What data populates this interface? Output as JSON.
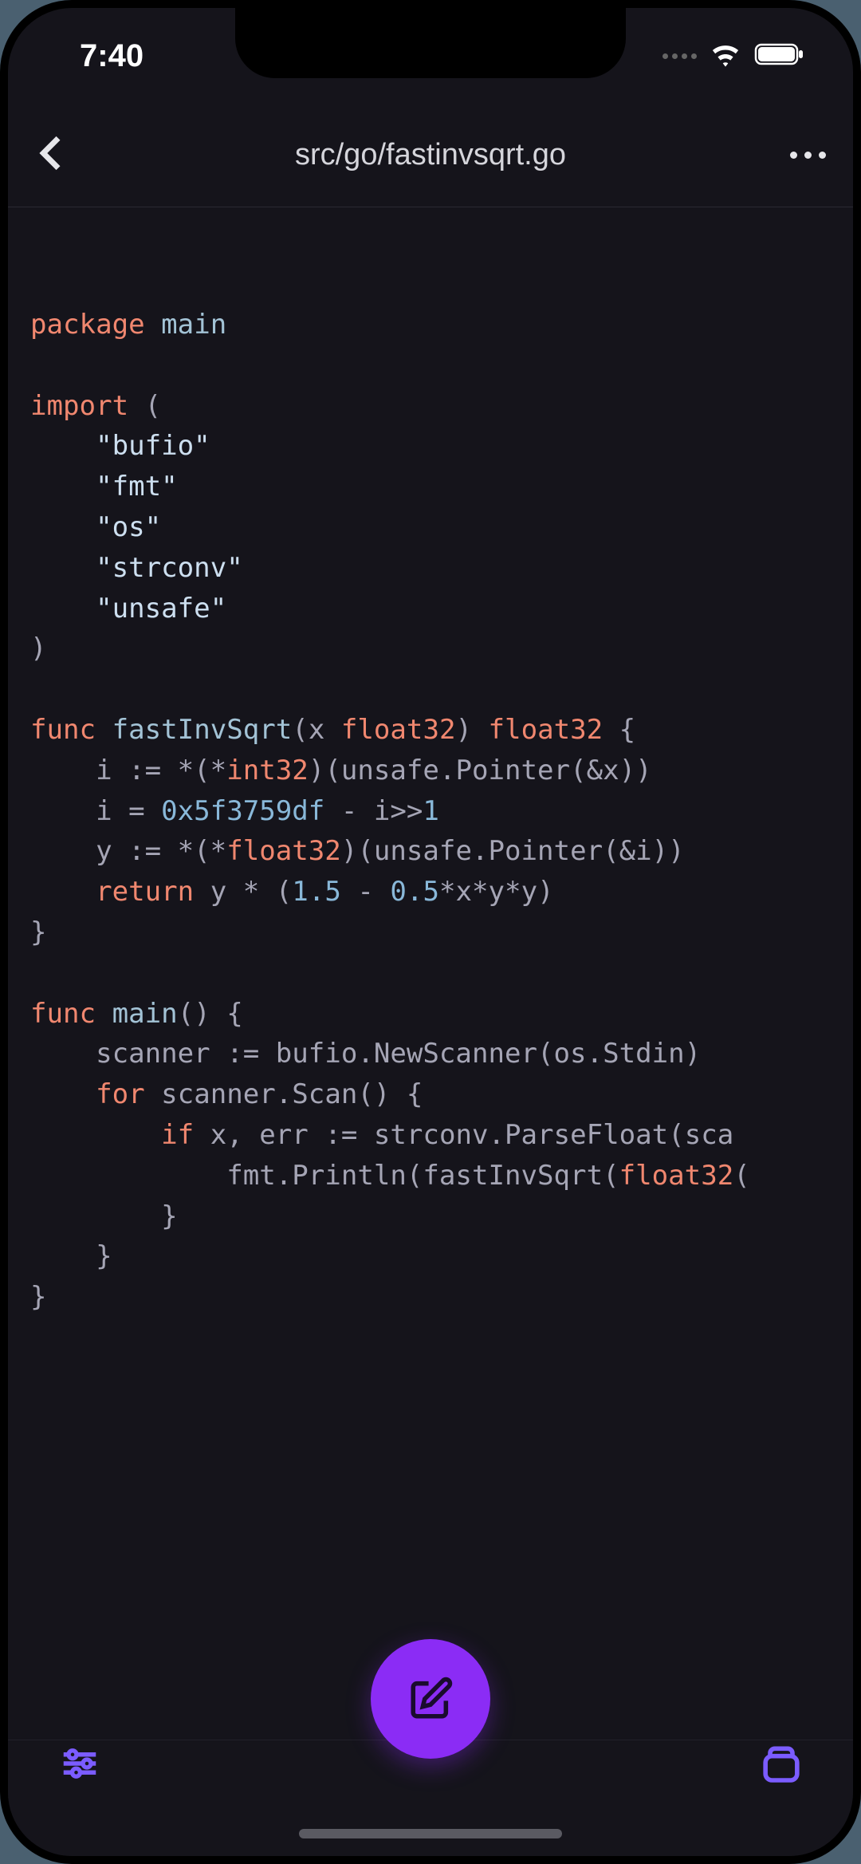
{
  "statusbar": {
    "time": "7:40"
  },
  "navbar": {
    "title": "src/go/fastinvsqrt.go"
  },
  "code": {
    "tokens": [
      [
        [
          "kw",
          "package"
        ],
        [
          "op",
          " "
        ],
        [
          "name",
          "main"
        ]
      ],
      [],
      [
        [
          "kw",
          "import"
        ],
        [
          "op",
          " ("
        ]
      ],
      [
        [
          "op",
          "    "
        ],
        [
          "str",
          "\"bufio\""
        ]
      ],
      [
        [
          "op",
          "    "
        ],
        [
          "str",
          "\"fmt\""
        ]
      ],
      [
        [
          "op",
          "    "
        ],
        [
          "str",
          "\"os\""
        ]
      ],
      [
        [
          "op",
          "    "
        ],
        [
          "str",
          "\"strconv\""
        ]
      ],
      [
        [
          "op",
          "    "
        ],
        [
          "str",
          "\"unsafe\""
        ]
      ],
      [
        [
          "op",
          ")"
        ]
      ],
      [],
      [
        [
          "kw",
          "func"
        ],
        [
          "op",
          " "
        ],
        [
          "name",
          "fastInvSqrt"
        ],
        [
          "op",
          "(x "
        ],
        [
          "type",
          "float32"
        ],
        [
          "op",
          ") "
        ],
        [
          "type",
          "float32"
        ],
        [
          "op",
          " {"
        ]
      ],
      [
        [
          "op",
          "    i := *(*"
        ],
        [
          "type",
          "int32"
        ],
        [
          "op",
          ")(unsafe.Pointer(&x))"
        ]
      ],
      [
        [
          "op",
          "    i = "
        ],
        [
          "num",
          "0x5f3759df"
        ],
        [
          "op",
          " - i>>"
        ],
        [
          "num",
          "1"
        ]
      ],
      [
        [
          "op",
          "    y := *(*"
        ],
        [
          "type",
          "float32"
        ],
        [
          "op",
          ")(unsafe.Pointer(&i))"
        ]
      ],
      [
        [
          "op",
          "    "
        ],
        [
          "kw",
          "return"
        ],
        [
          "op",
          " y * ("
        ],
        [
          "num",
          "1.5"
        ],
        [
          "op",
          " - "
        ],
        [
          "num",
          "0.5"
        ],
        [
          "op",
          "*x*y*y)"
        ]
      ],
      [
        [
          "op",
          "}"
        ]
      ],
      [],
      [
        [
          "kw",
          "func"
        ],
        [
          "op",
          " "
        ],
        [
          "name",
          "main"
        ],
        [
          "op",
          "() {"
        ]
      ],
      [
        [
          "op",
          "    scanner := bufio.NewScanner(os.Stdin)"
        ]
      ],
      [
        [
          "op",
          "    "
        ],
        [
          "kw",
          "for"
        ],
        [
          "op",
          " scanner.Scan() {"
        ]
      ],
      [
        [
          "op",
          "        "
        ],
        [
          "kw",
          "if"
        ],
        [
          "op",
          " x, err := strconv.ParseFloat(sca"
        ]
      ],
      [
        [
          "op",
          "            fmt.Println(fastInvSqrt("
        ],
        [
          "type",
          "float32"
        ],
        [
          "op",
          "("
        ]
      ],
      [
        [
          "op",
          "        }"
        ]
      ],
      [
        [
          "op",
          "    }"
        ]
      ],
      [
        [
          "op",
          "}"
        ]
      ]
    ]
  },
  "icons": {
    "back": "back-chevron",
    "more": "more-dots",
    "settings": "sliders",
    "files": "stack",
    "edit": "compose"
  }
}
